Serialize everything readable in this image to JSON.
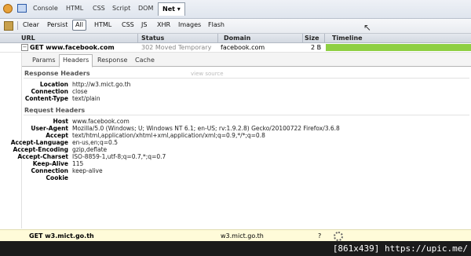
{
  "top_tabs": [
    "Console",
    "HTML",
    "CSS",
    "Script",
    "DOM"
  ],
  "active_top_tab": "Net ▾",
  "filters": {
    "clear": "Clear",
    "persist": "Persist",
    "all": "All",
    "html": "HTML",
    "css": "CSS",
    "js": "JS",
    "xhr": "XHR",
    "images": "Images",
    "flash": "Flash"
  },
  "columns": {
    "url": "URL",
    "status": "Status",
    "domain": "Domain",
    "size": "Size",
    "timeline": "Timeline"
  },
  "request": {
    "toggle": "−",
    "method_url": "GET www.facebook.com",
    "status": "302 Moved Temporary",
    "domain": "facebook.com",
    "size": "2 B",
    "timeline_fraction": 1.0
  },
  "sub_tabs": [
    "Params",
    "Headers",
    "Response",
    "Cache"
  ],
  "active_sub_tab": "Headers",
  "response_headers": {
    "title": "Response Headers",
    "view_source": "view source",
    "rows": [
      {
        "key": "Location",
        "value": "http://w3.mict.go.th"
      },
      {
        "key": "Connection",
        "value": "close"
      },
      {
        "key": "Content-Type",
        "value": "text/plain"
      }
    ]
  },
  "request_headers": {
    "title": "Request Headers",
    "rows": [
      {
        "key": "Host",
        "value": "www.facebook.com"
      },
      {
        "key": "User-Agent",
        "value": "Mozilla/5.0 (Windows; U; Windows NT 6.1; en-US; rv:1.9.2.8) Gecko/20100722 Firefox/3.6.8"
      },
      {
        "key": "Accept",
        "value": "text/html,application/xhtml+xml,application/xml;q=0.9,*/*;q=0.8"
      },
      {
        "key": "Accept-Language",
        "value": "en-us,en;q=0.5"
      },
      {
        "key": "Accept-Encoding",
        "value": "gzip,deflate"
      },
      {
        "key": "Accept-Charset",
        "value": "ISO-8859-1,utf-8;q=0.7,*;q=0.7"
      },
      {
        "key": "Keep-Alive",
        "value": "115"
      },
      {
        "key": "Connection",
        "value": "keep-alive"
      },
      {
        "key": "Cookie",
        "value": ""
      }
    ]
  },
  "pending_request": {
    "method_url": "GET w3.mict.go.th",
    "domain": "w3.mict.go.th",
    "size": "?"
  },
  "watermark": "[861x439] https://upic.me/",
  "colors": {
    "timeline": "#8ecf43",
    "pending_bg": "#fffbd9"
  }
}
